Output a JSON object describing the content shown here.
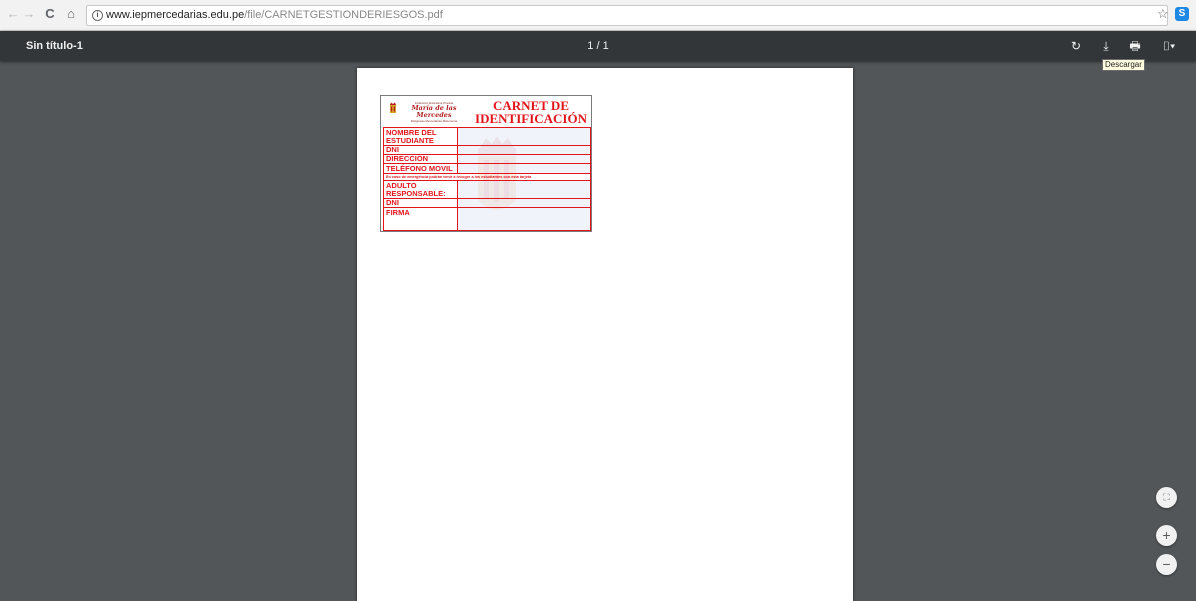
{
  "browser": {
    "back_icon": "←",
    "forward_icon": "→",
    "reload_icon": "C",
    "home_icon": "⌂",
    "url_host": "www.iepmercedarias.edu.pe",
    "url_path": "/file/CARNETGESTIONDERIESGOS.pdf",
    "info_icon": "i",
    "star_icon": "☆",
    "extension_icon": "S"
  },
  "pdf_toolbar": {
    "title": "Sin título-1",
    "page_indicator": "1 / 1",
    "rotate_icon": "↻",
    "download_icon": "⤓",
    "print_icon": "🖶",
    "bookmark_icon": "⌷▾",
    "tooltip": "Descargar"
  },
  "card": {
    "school_top": "Institución Educativa Privada",
    "school_name": "María de las Mercedes",
    "school_bottom": "Religiosas Mercedarias Misioneras",
    "title_line1": "CARNET DE",
    "title_line2": "IDENTIFICACIÓN",
    "fields": {
      "nombre": "NOMBRE DEL ESTUDIANTE",
      "dni": "DNI",
      "direccion": "DIRECCION",
      "telefono": "TELÉFONO MOVIL",
      "adulto": "ADULTO RESPONSABLE:",
      "dni2": "DNI",
      "firma": "FIRMA"
    },
    "emergency_notice": "En caso de emergencia podrán venir a recoger a los estudiantes con esta tarjeta",
    "accent_color": "#e3151b"
  },
  "zoom_controls": {
    "fit_icon": "⛶",
    "zoom_in_icon": "+",
    "zoom_out_icon": "−"
  }
}
